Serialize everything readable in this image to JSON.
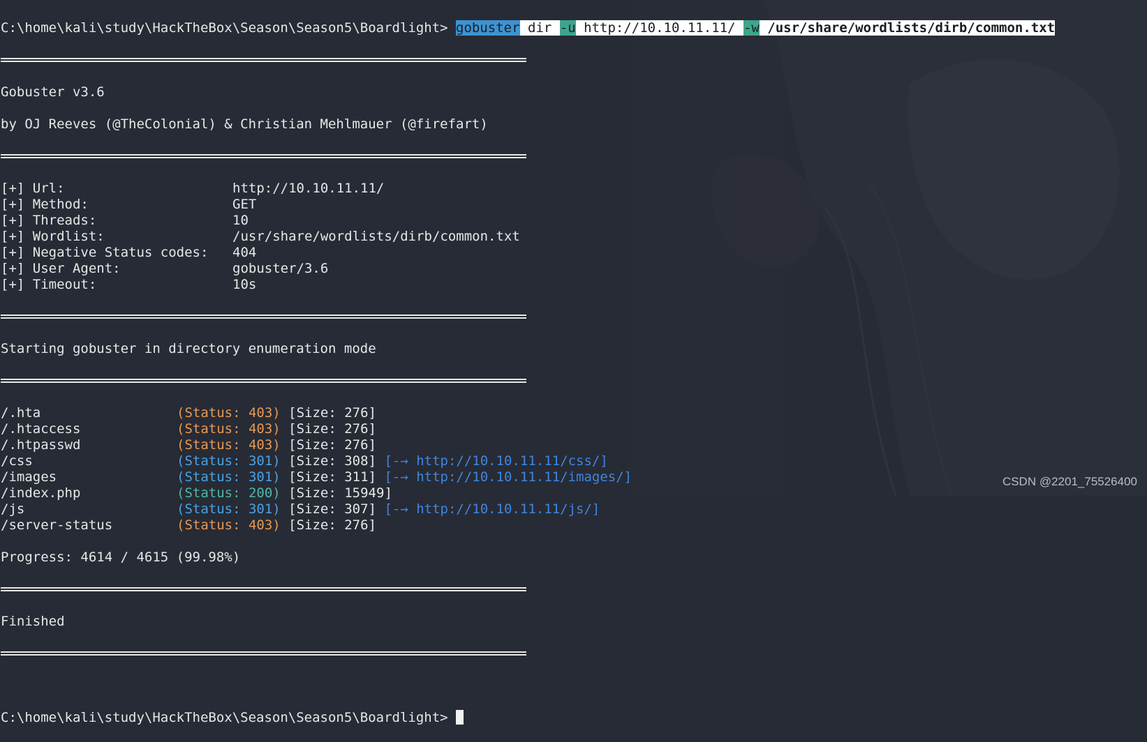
{
  "terminal": {
    "prompt": "C:\\home\\kali\\study\\HackTheBox\\Season\\Season5\\Boardlight>",
    "command": {
      "program": "gobuster",
      "subcommand": "dir",
      "flag_u": "-u",
      "url": "http://10.10.11.11/",
      "flag_w": "-w",
      "wordlist": "/usr/share/wordlists/dirb/common.txt"
    },
    "banner": {
      "version": "Gobuster v3.6",
      "authors": "by OJ Reeves (@TheColonial) & Christian Mehlmauer (@firefart)"
    },
    "config": [
      {
        "key": "[+] Url:",
        "value": "http://10.10.11.11/"
      },
      {
        "key": "[+] Method:",
        "value": "GET"
      },
      {
        "key": "[+] Threads:",
        "value": "10"
      },
      {
        "key": "[+] Wordlist:",
        "value": "/usr/share/wordlists/dirb/common.txt"
      },
      {
        "key": "[+] Negative Status codes:",
        "value": "404"
      },
      {
        "key": "[+] User Agent:",
        "value": "gobuster/3.6"
      },
      {
        "key": "[+] Timeout:",
        "value": "10s"
      }
    ],
    "mode_message": "Starting gobuster in directory enumeration mode",
    "results": [
      {
        "path": "/.hta",
        "status": "(Status: 403)",
        "code": "403",
        "size": "[Size: 276]",
        "redirect": ""
      },
      {
        "path": "/.htaccess",
        "status": "(Status: 403)",
        "code": "403",
        "size": "[Size: 276]",
        "redirect": ""
      },
      {
        "path": "/.htpasswd",
        "status": "(Status: 403)",
        "code": "403",
        "size": "[Size: 276]",
        "redirect": ""
      },
      {
        "path": "/css",
        "status": "(Status: 301)",
        "code": "301",
        "size": "[Size: 308]",
        "redirect": "[-→ http://10.10.11.11/css/]"
      },
      {
        "path": "/images",
        "status": "(Status: 301)",
        "code": "301",
        "size": "[Size: 311]",
        "redirect": "[-→ http://10.10.11.11/images/]"
      },
      {
        "path": "/index.php",
        "status": "(Status: 200)",
        "code": "200",
        "size": "[Size: 15949]",
        "redirect": ""
      },
      {
        "path": "/js",
        "status": "(Status: 301)",
        "code": "301",
        "size": "[Size: 307]",
        "redirect": "[-→ http://10.10.11.11/js/]"
      },
      {
        "path": "/server-status",
        "status": "(Status: 403)",
        "code": "403",
        "size": "[Size: 276]",
        "redirect": ""
      }
    ],
    "progress": "Progress: 4614 / 4615 (99.98%)",
    "finished": "Finished",
    "final_prompt": "C:\\home\\kali\\study\\HackTheBox\\Season\\Season5\\Boardlight>"
  },
  "watermark": "CSDN @2201_75526400",
  "colors": {
    "background": "#272b35",
    "status_403": "#e79a53",
    "status_301": "#4aa2e6",
    "status_200": "#4fb8a6",
    "redirect": "#3f86e0"
  }
}
